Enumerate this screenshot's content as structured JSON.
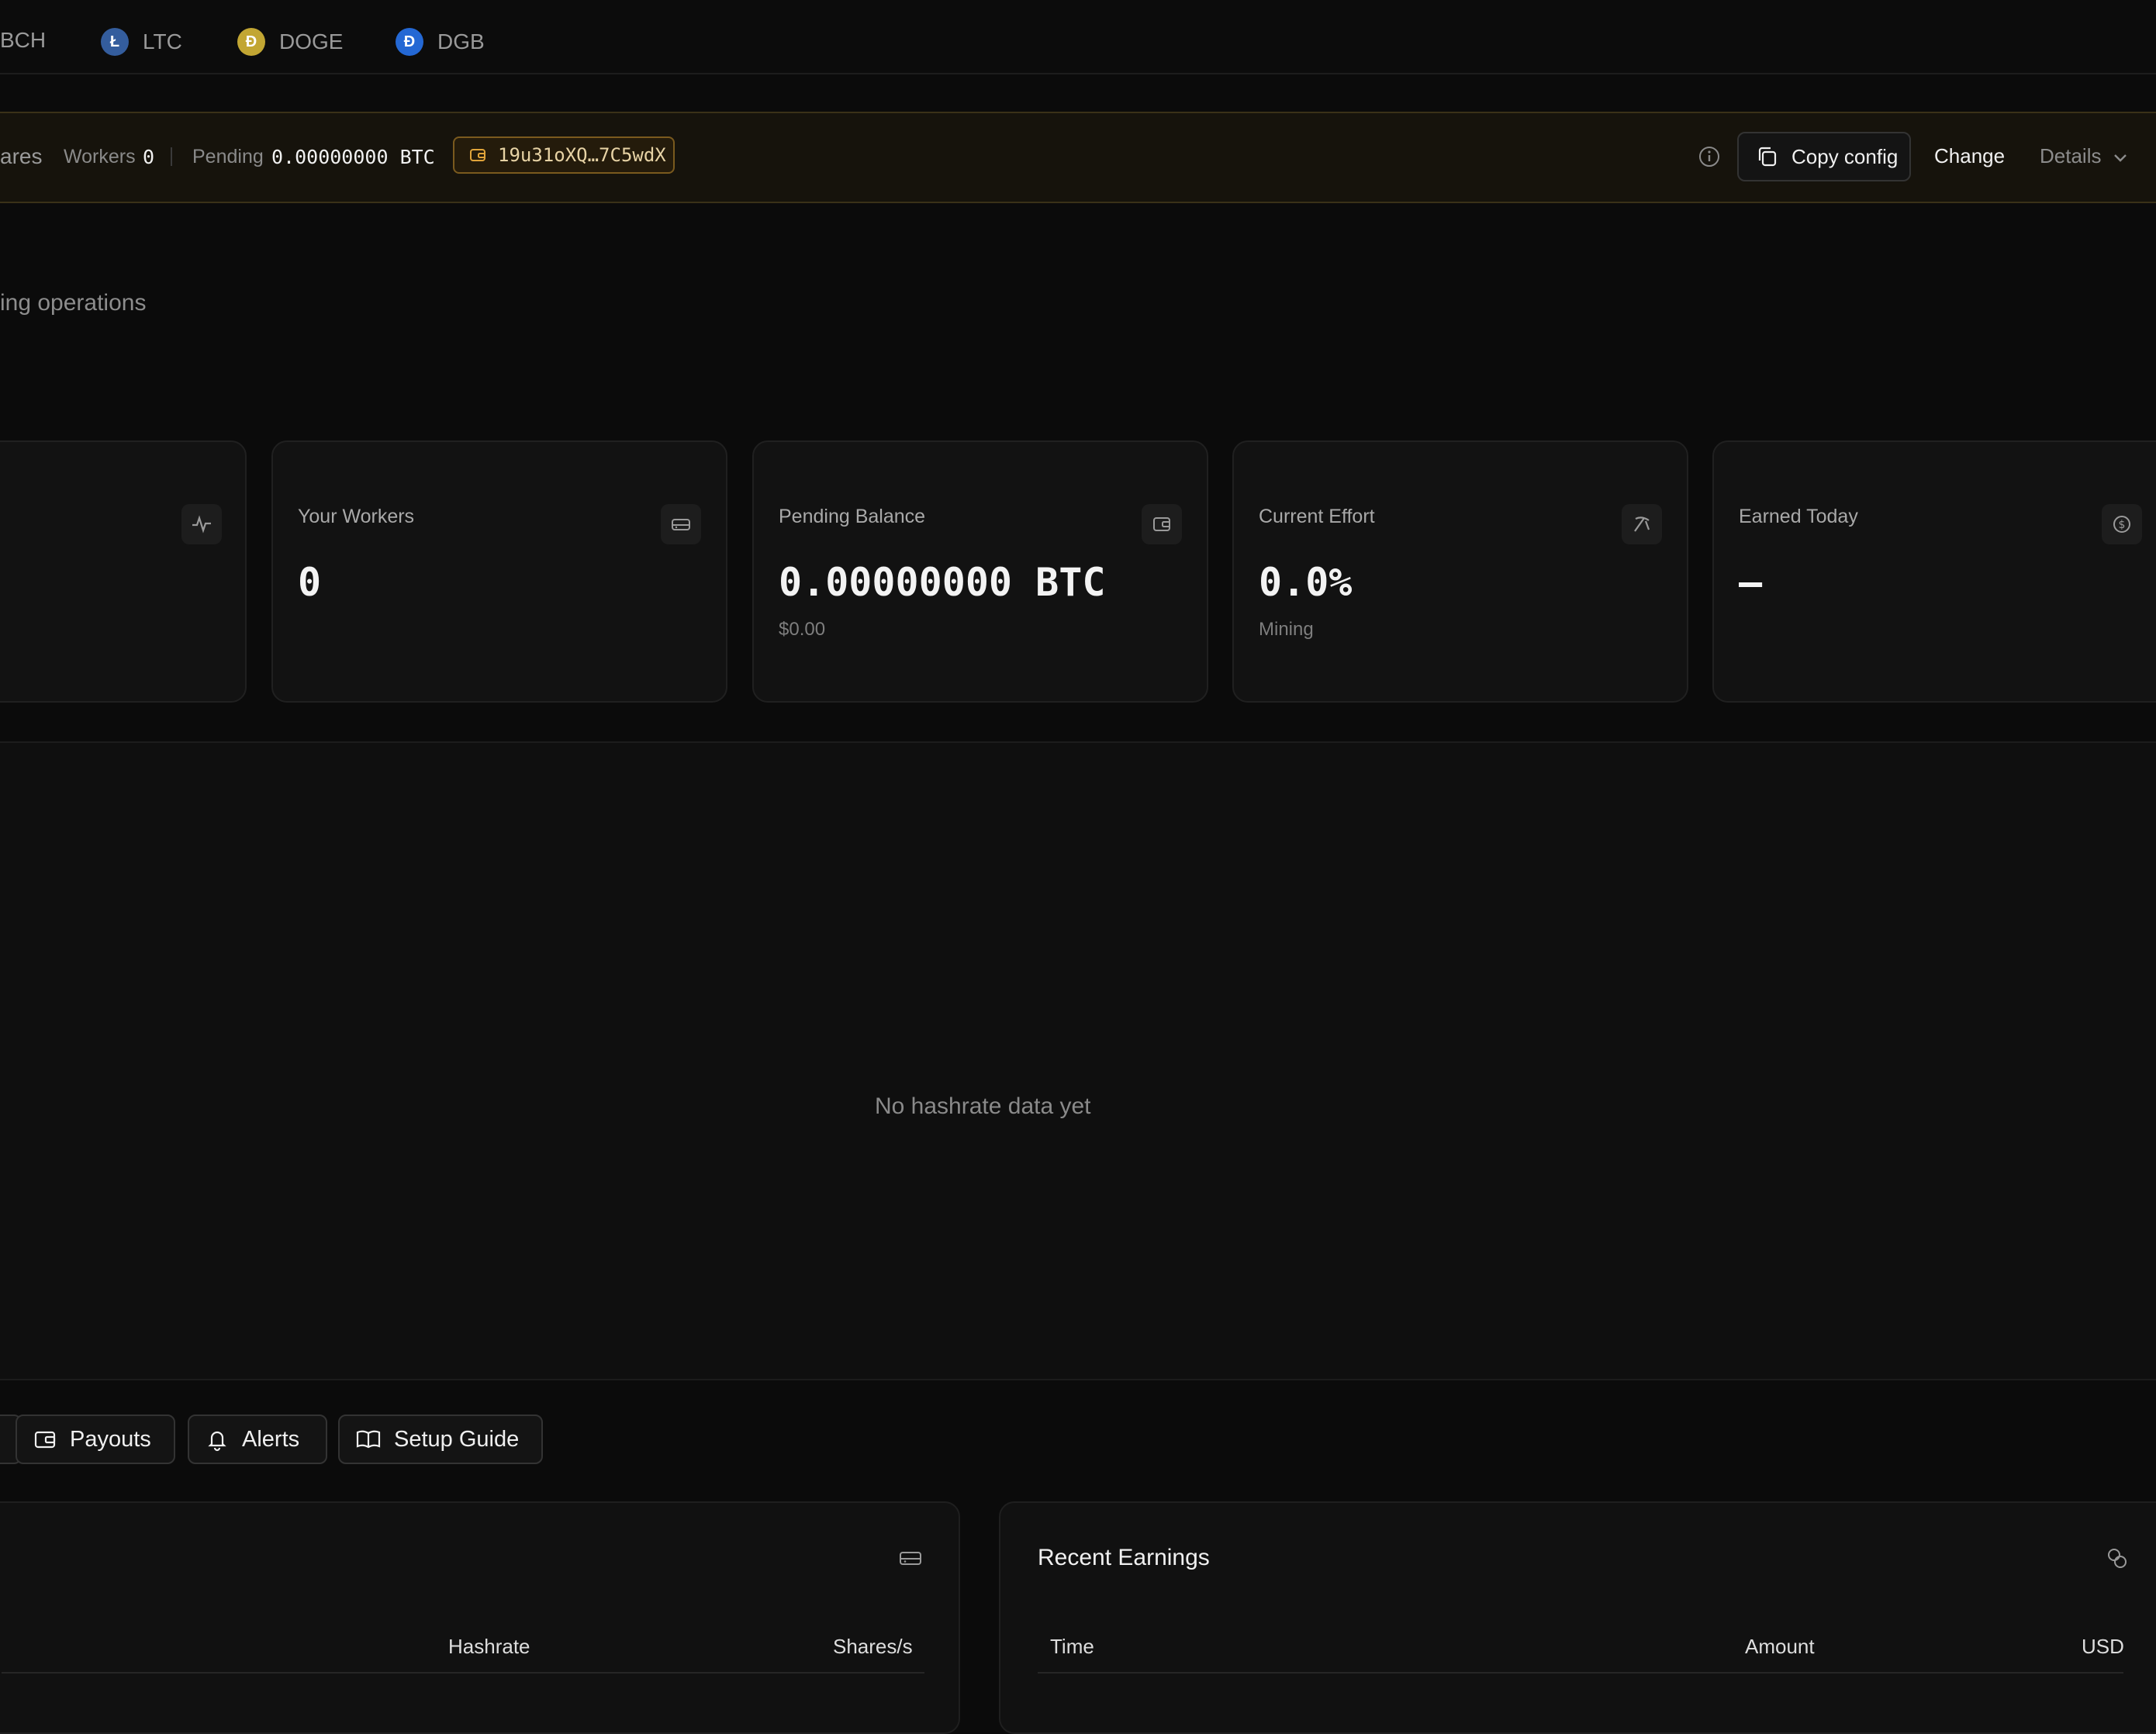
{
  "coins": [
    {
      "label": "BCH",
      "icon": "bch-coin-icon"
    },
    {
      "label": "LTC",
      "icon": "ltc-coin-icon",
      "glyph": "Ł",
      "color": "#345d9d"
    },
    {
      "label": "DOGE",
      "icon": "doge-coin-icon",
      "glyph": "Ð",
      "color": "#c2a633"
    },
    {
      "label": "DGB",
      "icon": "dgb-coin-icon",
      "glyph": "Ɖ",
      "color": "#2468d4"
    }
  ],
  "status": {
    "shares_fragment": "ares",
    "workers_label": "Workers",
    "workers_value": "0",
    "pending_label": "Pending",
    "pending_value": "0.00000000 BTC",
    "address": "19u31oXQ…7C5wdX",
    "copy_config": "Copy config",
    "change": "Change",
    "details": "Details"
  },
  "subtitle": "ing operations",
  "cards": [
    {
      "title": "Your Workers",
      "value": "0",
      "sub": "",
      "icon": "server-icon"
    },
    {
      "title": "Pending Balance",
      "value": "0.00000000 BTC",
      "sub": "$0.00",
      "icon": "wallet-icon"
    },
    {
      "title": "Current Effort",
      "value": "0.0%",
      "sub": "Mining",
      "icon": "pickaxe-icon"
    },
    {
      "title": "Earned Today",
      "value": "—",
      "sub": "",
      "icon": "dollar-circle-icon"
    }
  ],
  "chart": {
    "empty_text": "No hashrate data yet"
  },
  "tabs": {
    "payouts": "Payouts",
    "alerts": "Alerts",
    "setup": "Setup Guide"
  },
  "workers_panel": {
    "columns": [
      "Hashrate",
      "Shares/s"
    ]
  },
  "earnings_panel": {
    "title": "Recent Earnings",
    "columns": [
      "Time",
      "Amount",
      "USD"
    ]
  },
  "colors": {
    "accent": "#c99a3c",
    "background": "#0b0b0b",
    "card": "#121212"
  }
}
